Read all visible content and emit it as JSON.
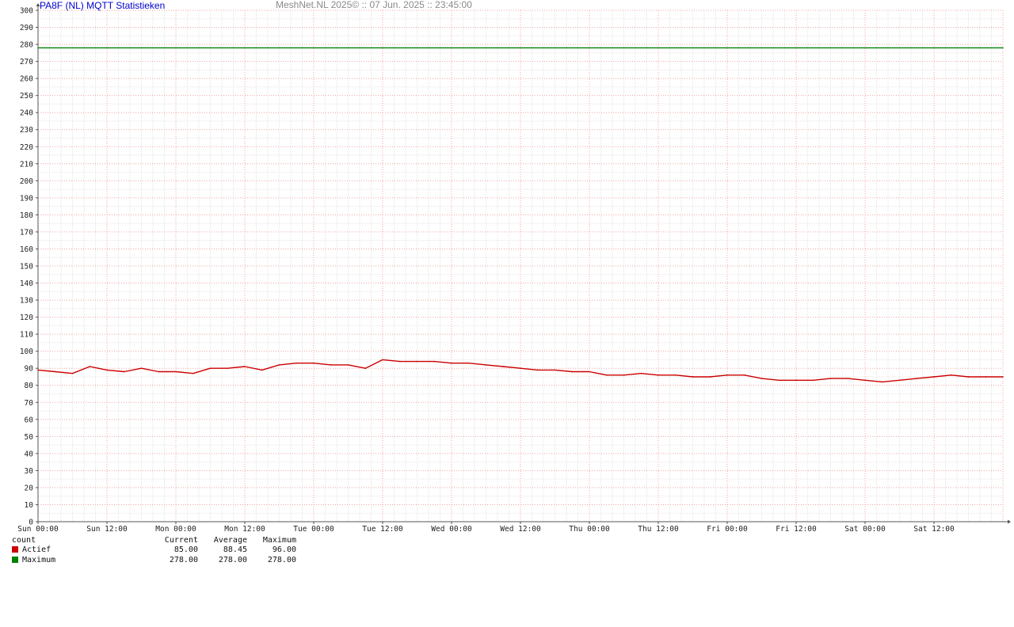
{
  "header": {
    "title": "PA8F (NL) MQTT Statistieken",
    "subtitle": "MeshNet.NL 2025© ::  07 Jun. 2025 :: 23:45:00"
  },
  "chart_data": {
    "type": "line",
    "title": "PA8F (NL) MQTT Statistieken",
    "subtitle": "MeshNet.NL 2025© ::  07 Jun. 2025 :: 23:45:00",
    "ylabel": "count",
    "ylim": [
      0,
      300
    ],
    "ytick_step": 10,
    "grid": true,
    "x_ticks": [
      "Sun 00:00",
      "Sun 12:00",
      "Mon 00:00",
      "Mon 12:00",
      "Tue 00:00",
      "Tue 12:00",
      "Wed 00:00",
      "Wed 12:00",
      "Thu 00:00",
      "Thu 12:00",
      "Fri 00:00",
      "Fri 12:00",
      "Sat 00:00",
      "Sat 12:00"
    ],
    "x_range_hours": [
      0,
      168
    ],
    "series": [
      {
        "name": "Actief",
        "color": "#cc0000",
        "x_hours": [
          0,
          3,
          6,
          9,
          12,
          15,
          18,
          21,
          24,
          27,
          30,
          33,
          36,
          39,
          42,
          45,
          48,
          51,
          54,
          57,
          60,
          63,
          66,
          69,
          72,
          75,
          78,
          81,
          84,
          87,
          90,
          93,
          96,
          99,
          102,
          105,
          108,
          111,
          114,
          117,
          120,
          123,
          126,
          129,
          132,
          135,
          138,
          141,
          144,
          147,
          150,
          153,
          156,
          159,
          162,
          165,
          168
        ],
        "values": [
          89,
          88,
          87,
          91,
          89,
          88,
          90,
          88,
          88,
          87,
          90,
          90,
          91,
          89,
          92,
          93,
          93,
          92,
          92,
          90,
          95,
          94,
          94,
          94,
          93,
          93,
          92,
          91,
          90,
          89,
          89,
          88,
          88,
          86,
          86,
          87,
          86,
          86,
          85,
          85,
          86,
          86,
          84,
          83,
          83,
          83,
          84,
          84,
          83,
          82,
          83,
          84,
          85,
          86,
          85,
          85,
          85
        ]
      },
      {
        "name": "Maximum",
        "color": "#008000",
        "x_hours": [
          0,
          168
        ],
        "values": [
          278,
          278
        ]
      }
    ]
  },
  "legend": {
    "unit": "count",
    "columns": [
      "Current",
      "Average",
      "Maximum"
    ],
    "rows": [
      {
        "name": "Actief",
        "color": "#cc0000",
        "current": "85.00",
        "average": "88.45",
        "maximum": "96.00"
      },
      {
        "name": "Maximum",
        "color": "#008000",
        "current": "278.00",
        "average": "278.00",
        "maximum": "278.00"
      }
    ]
  }
}
